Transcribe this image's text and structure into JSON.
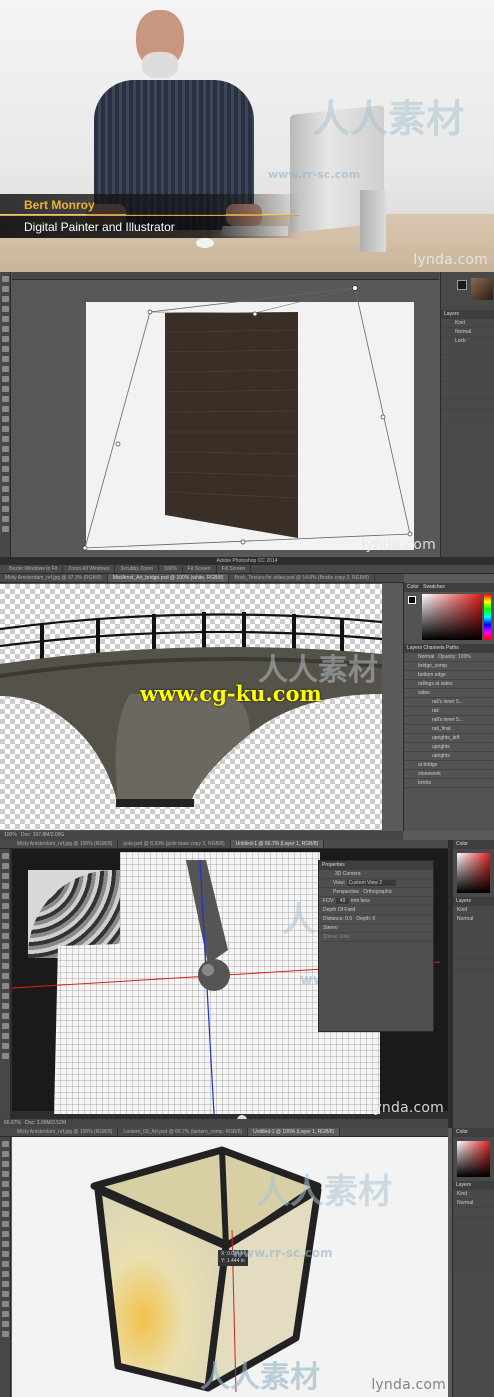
{
  "presenter": {
    "name": "Bert Monroy",
    "title": "Digital Painter and Illustrator"
  },
  "brand": "lynda.com",
  "watermarks": {
    "url_overlay": "www.cg-ku.com",
    "cn_text": "人人素材",
    "cn_url": "www.rr-sc.com"
  },
  "frame2": {
    "tabs": [
      "Brick_Texture for sides.psd @ 14.8% (Bricks copy 2, RGB/8)"
    ]
  },
  "frame3": {
    "app_title": "Adobe Photoshop CC 2014",
    "options": [
      "Bezier Windows to Fit",
      "Zoom All Windows",
      "Scrubby Zoom",
      "100%",
      "Fit Screen",
      "Fill Screen"
    ],
    "tabs": [
      "Misty Amsterdam_ref.jpg @ 97.3% (RGB/8)",
      "MistAmst_Art_bridge.psd @ 100% (white, RGB/8)",
      "Brick_Texture for sides.psd @ 14.8% (Bricks copy 2, RGB/8)"
    ],
    "panel_tabs": [
      "Color",
      "Swatches"
    ],
    "layers_tabs": [
      "Layers",
      "Channels",
      "Paths"
    ],
    "blend": "Normal",
    "opacity": "Opacity: 100%",
    "layers": [
      "bridge_comp",
      "bottom edge",
      "railings at sides",
      "sides",
      "rail's inner 5...",
      "rail",
      "rail's inner 5...",
      "rail_final",
      "uprights_left",
      "uprights",
      "uprights",
      "at bridge",
      "stonework",
      "bricks"
    ],
    "status": "Doc: 197.8M/2.00G",
    "zoom": "100%"
  },
  "frame4": {
    "tabs": [
      "Misty Amsterdam_ref.jpg @ 100% (RGB/8)",
      "pole.psd @ 8.33% (pole base copy 2, RGB/8)",
      "Untitled-1 @ 66.7% (Layer 1, RGB/8)"
    ],
    "properties": {
      "title": "Properties",
      "section": "3D Camera",
      "view_label": "View:",
      "view_value": "Custom View 2",
      "perspective": "Perspective",
      "orthographic": "Orthographic",
      "fov_label": "FOV:",
      "fov_value": "49",
      "fov_unit": "mm lens",
      "dof": "Depth Of Field",
      "distance_label": "Distance:",
      "distance_value": "0.5",
      "depth_label": "Depth:",
      "depth_value": "0",
      "stereo": "Stereo",
      "stereo_view": "Stereo View"
    },
    "status": "Doc: 3.09M/3.52M",
    "zoom": "66.67%"
  },
  "frame5": {
    "tabs": [
      "Misty Amsterdam_ref.jpg @ 100% (RGB/8)",
      "Lantern_03_Art.psd @ 66.7% (lantern_comp, RGB/8)",
      "Untitled-1 @ 100% (Layer 1, RGB/8)"
    ],
    "tooltip": [
      "X: 0.014 in",
      "Y: 1.444 in"
    ]
  },
  "panel_small": {
    "color": "Color",
    "layers": "Layers",
    "kind": "Kind",
    "normal": "Normal",
    "lock": "Lock:"
  }
}
